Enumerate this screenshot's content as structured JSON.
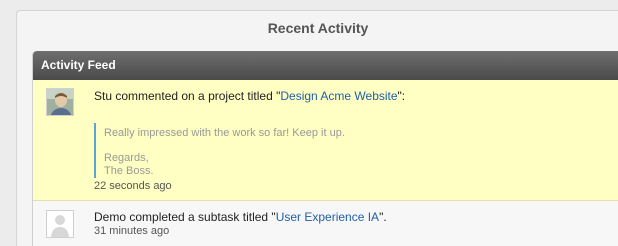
{
  "page": {
    "title": "Recent Activity"
  },
  "feed": {
    "title": "Activity Feed",
    "items": [
      {
        "prefix": "Stu commented on a project titled ",
        "quote_open": "\"",
        "link": "Design Acme Website",
        "quote_close": "\":",
        "comment_line1": "Really impressed with the work so far! Keep it up.",
        "comment_line2": "Regards,",
        "comment_line3": "The Boss.",
        "time": "22 seconds ago",
        "highlighted": true
      },
      {
        "prefix": "Demo completed a subtask titled ",
        "quote_open": "\"",
        "link": "User Experience IA",
        "quote_close": "\".",
        "time": "31 minutes ago",
        "highlighted": false
      }
    ]
  },
  "colors": {
    "highlight": "#ffffc4",
    "link": "#1f5fa8",
    "quote_bar": "#5aa7d6",
    "header": "#4a4a4a"
  }
}
